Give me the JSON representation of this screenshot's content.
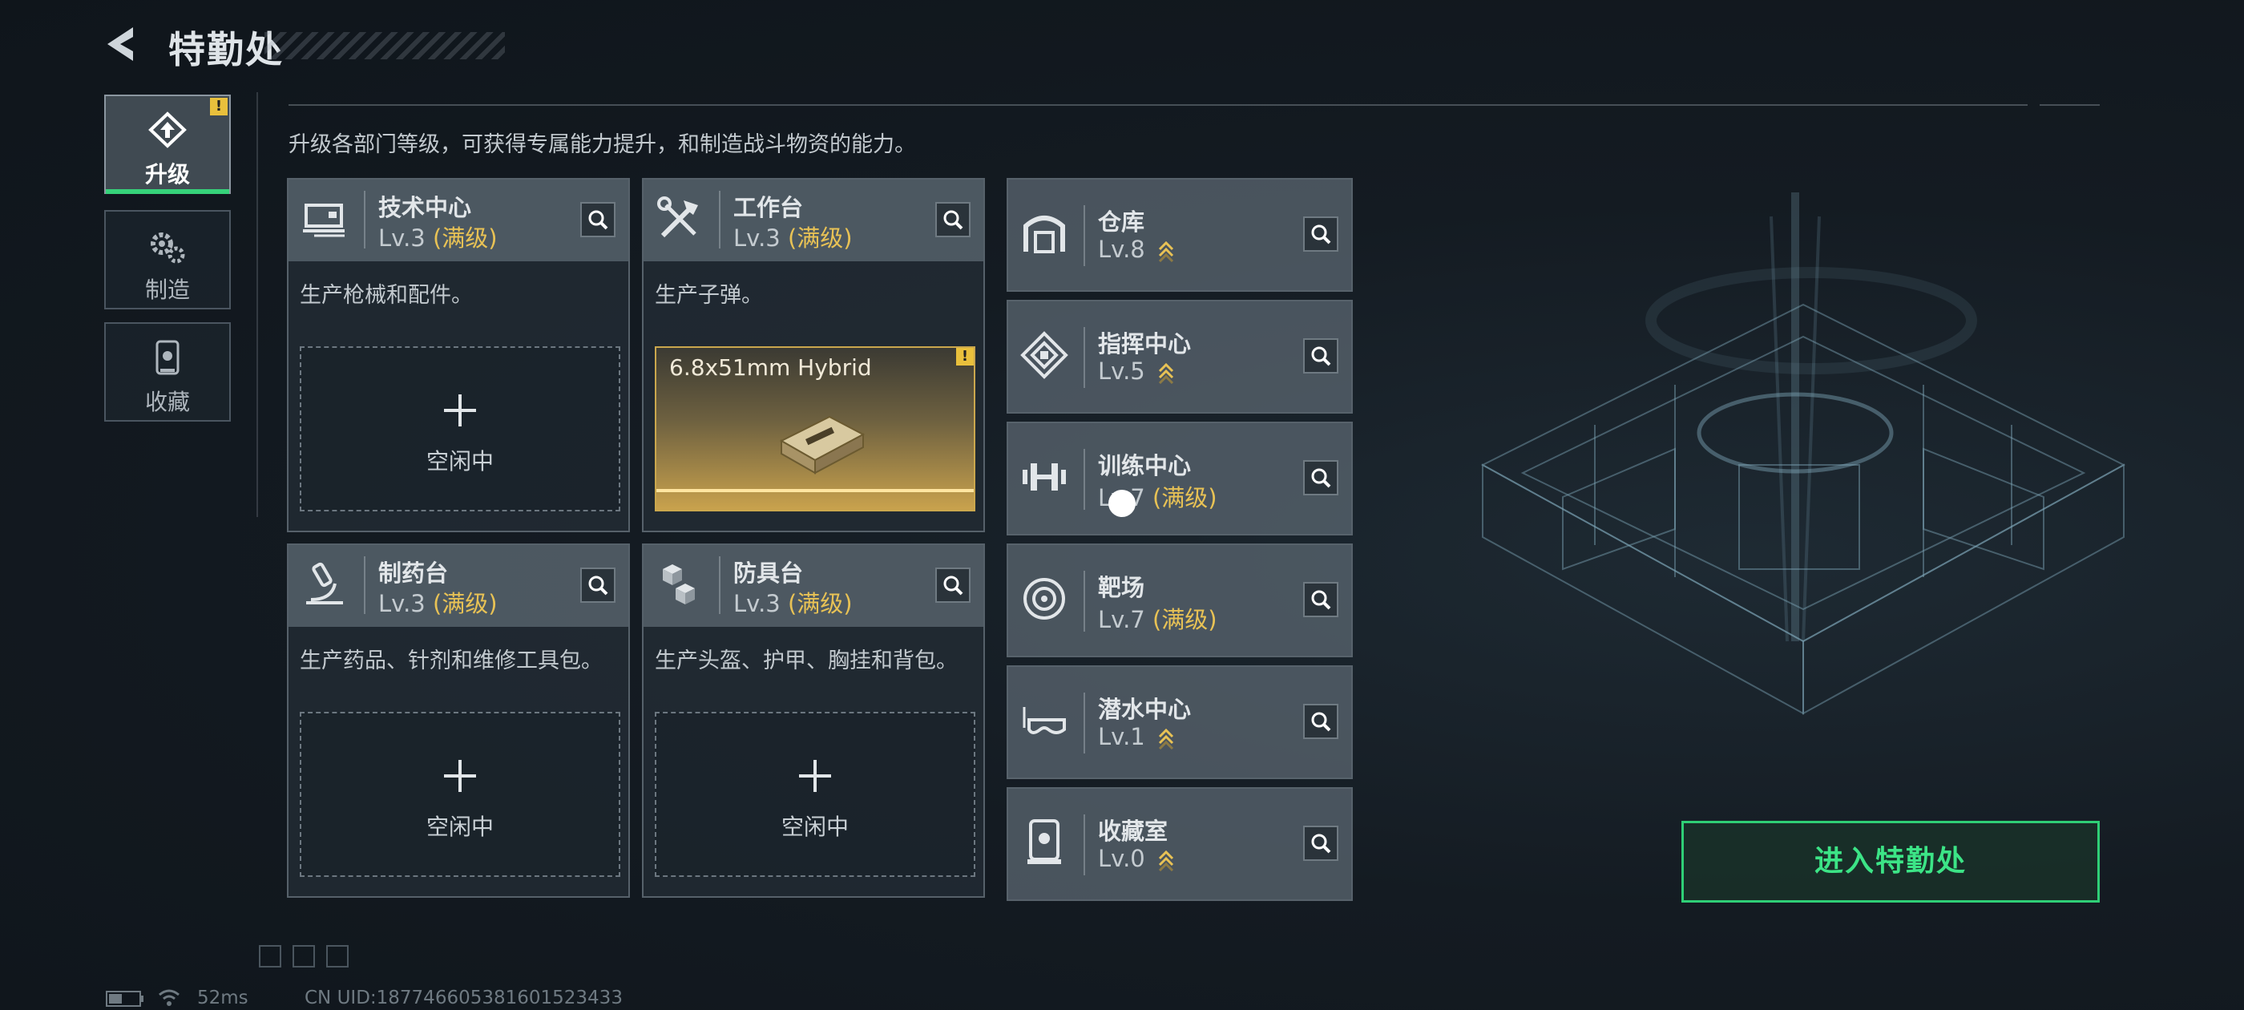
{
  "header": {
    "title": "特勤处"
  },
  "sidebar": {
    "tabs": [
      {
        "label": "升级",
        "icon": "upgrade-icon",
        "active": true,
        "alert": "!"
      },
      {
        "label": "制造",
        "icon": "gears-icon",
        "active": false
      },
      {
        "label": "收藏",
        "icon": "collection-icon",
        "active": false
      }
    ]
  },
  "main": {
    "description": "升级各部门等级，可获得专属能力提升，和制造战斗物资的能力。",
    "departments": [
      {
        "name": "技术中心",
        "level": "Lv.3",
        "status": "(满级)",
        "icon": "tech-center-icon",
        "desc": "生产枪械和配件。",
        "slot": "空闲中"
      },
      {
        "name": "工作台",
        "level": "Lv.3",
        "status": "(满级)",
        "icon": "workbench-icon",
        "desc": "生产子弹。",
        "crafting": {
          "item": "6.8x51mm Hybrid",
          "alert": "!"
        }
      },
      {
        "name": "制药台",
        "level": "Lv.3",
        "status": "(满级)",
        "icon": "pharmacy-icon",
        "desc": "生产药品、针剂和维修工具包。",
        "slot": "空闲中"
      },
      {
        "name": "防具台",
        "level": "Lv.3",
        "status": "(满级)",
        "icon": "armor-bench-icon",
        "desc": "生产头盔、护甲、胸挂和背包。",
        "slot": "空闲中"
      }
    ],
    "facilities": [
      {
        "name": "仓库",
        "level": "Lv.8",
        "status": "",
        "upgradable": true,
        "icon": "warehouse-icon"
      },
      {
        "name": "指挥中心",
        "level": "Lv.5",
        "status": "",
        "upgradable": true,
        "icon": "command-center-icon"
      },
      {
        "name": "训练中心",
        "level": "Lv.7",
        "status": "(满级)",
        "upgradable": false,
        "icon": "dumbbell-icon"
      },
      {
        "name": "靶场",
        "level": "Lv.7",
        "status": "(满级)",
        "upgradable": false,
        "icon": "target-icon"
      },
      {
        "name": "潜水中心",
        "level": "Lv.1",
        "status": "",
        "upgradable": true,
        "icon": "diving-mask-icon"
      },
      {
        "name": "收藏室",
        "level": "Lv.0",
        "status": "",
        "upgradable": true,
        "icon": "display-case-icon"
      }
    ]
  },
  "enter_button": "进入特勤处",
  "status_bar": {
    "ping": "52ms",
    "uid": "CN UID:18774660538160152343​3"
  },
  "colors": {
    "accent_green": "#36d27a",
    "maxed_gold": "#e8c255",
    "alert_yellow": "#e9c03c"
  }
}
